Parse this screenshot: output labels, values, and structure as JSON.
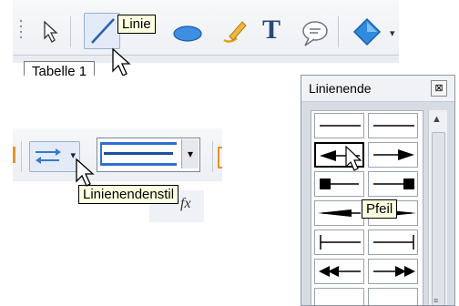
{
  "panel1": {
    "tooltip": "Linie",
    "tab_label": "Tabelle 1"
  },
  "panel2": {
    "tooltip": "Linienendenstil"
  },
  "panel3": {
    "title": "Linienende",
    "close_glyph": "⊠",
    "tooltip": "Pfeil",
    "scroll_up": "▲",
    "scroll_grip": "≡"
  }
}
